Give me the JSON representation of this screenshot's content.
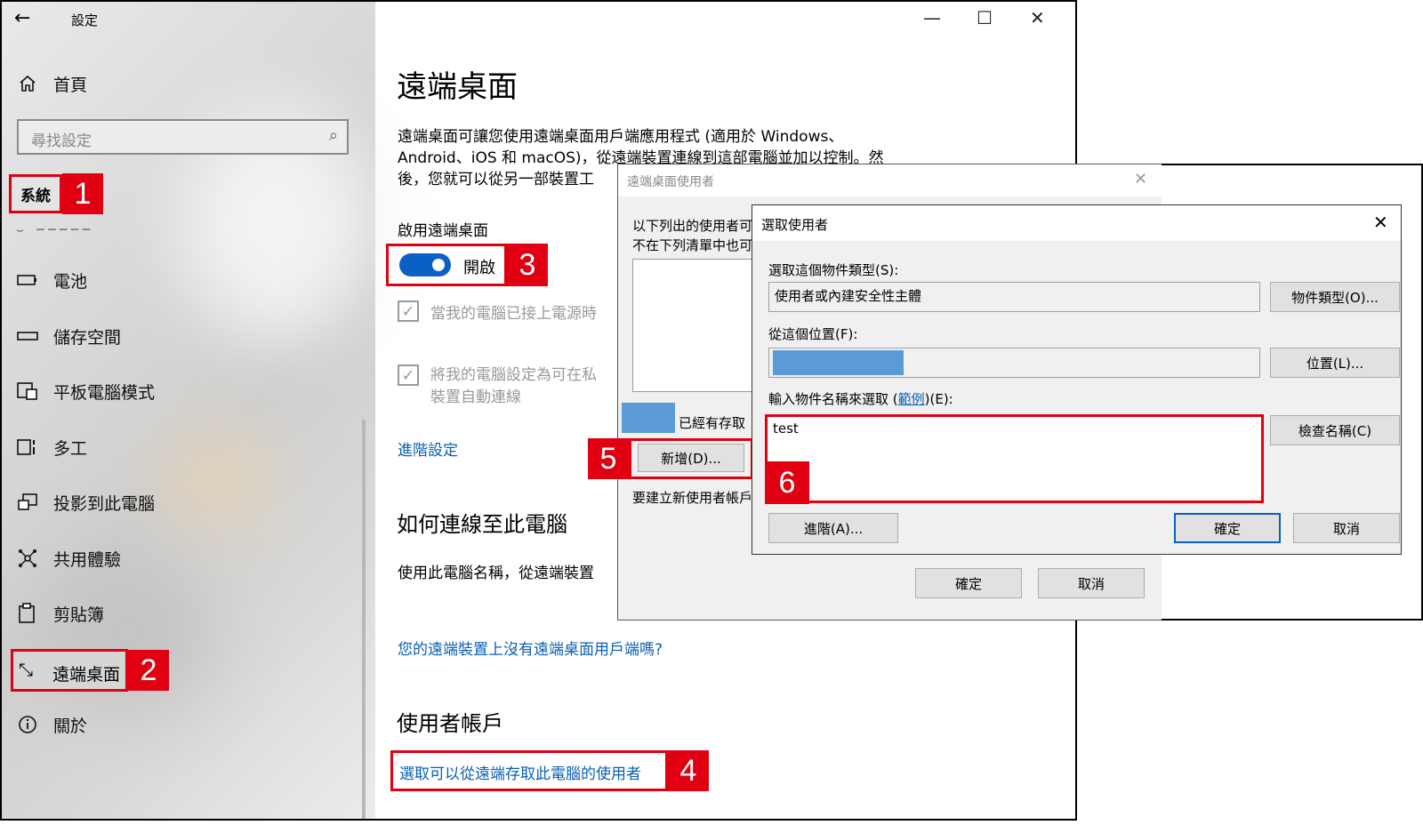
{
  "window": {
    "title": "設定",
    "back_icon": "arrow-left",
    "min": "—",
    "max": "☐",
    "close": "✕"
  },
  "sidebar": {
    "home": "首頁",
    "search_placeholder": "尋找設定",
    "section": "系統",
    "items": [
      {
        "label": "電池",
        "icon": "battery-icon"
      },
      {
        "label": "儲存空間",
        "icon": "storage-icon"
      },
      {
        "label": "平板電腦模式",
        "icon": "tablet-icon"
      },
      {
        "label": "多工",
        "icon": "multitask-icon"
      },
      {
        "label": "投影到此電腦",
        "icon": "project-icon"
      },
      {
        "label": "共用體驗",
        "icon": "share-icon"
      },
      {
        "label": "剪貼簿",
        "icon": "clipboard-icon"
      },
      {
        "label": "遠端桌面",
        "icon": "remote-icon"
      },
      {
        "label": "關於",
        "icon": "info-icon"
      }
    ]
  },
  "main": {
    "title": "遠端桌面",
    "desc_line1": "遠端桌面可讓您使用遠端桌面用戶端應用程式 (適用於 Windows、",
    "desc_line2": "Android、iOS 和 macOS)，從遠端裝置連線到這部電腦並加以控制。然",
    "desc_line3": "後，您就可以從另一部裝置工",
    "enable_label": "啟用遠端桌面",
    "toggle_state": "開啟",
    "check1": "當我的電腦已接上電源時",
    "check2_line1": "將我的電腦設定為可在私",
    "check2_line2": "裝置自動連線",
    "advanced": "進階設定",
    "how_title": "如何連線至此電腦",
    "how_desc": "使用此電腦名稱，從遠端裝置",
    "no_client": "您的遠端裝置上沒有遠端桌面用戶端嗎?",
    "accounts_title": "使用者帳戶",
    "select_users": "選取可以從遠端存取此電腦的使用者"
  },
  "rd_users": {
    "title": "遠端桌面使用者",
    "line1": "以下列出的使用者可",
    "line2": "不在下列清單中也可",
    "has_access": "已經有存取",
    "add": "新增(D)...",
    "create": "要建立新使用者帳戶",
    "ok": "確定",
    "cancel": "取消"
  },
  "select_user": {
    "title": "選取使用者",
    "type_label": "選取這個物件類型(S):",
    "type_value": "使用者或內建安全性主體",
    "type_btn": "物件類型(O)...",
    "loc_label": "從這個位置(F):",
    "loc_btn": "位置(L)...",
    "name_label_pre": "輸入物件名稱來選取 (",
    "name_label_link": "範例",
    "name_label_post": ")(E):",
    "name_value": "test",
    "check_btn": "檢查名稱(C)",
    "advanced_btn": "進階(A)...",
    "ok": "確定",
    "cancel": "取消"
  },
  "steps": [
    "1",
    "2",
    "3",
    "4",
    "5",
    "6"
  ],
  "colors": {
    "accent": "#0a60c4",
    "highlight": "#e00012",
    "link": "#0a5fb5"
  }
}
